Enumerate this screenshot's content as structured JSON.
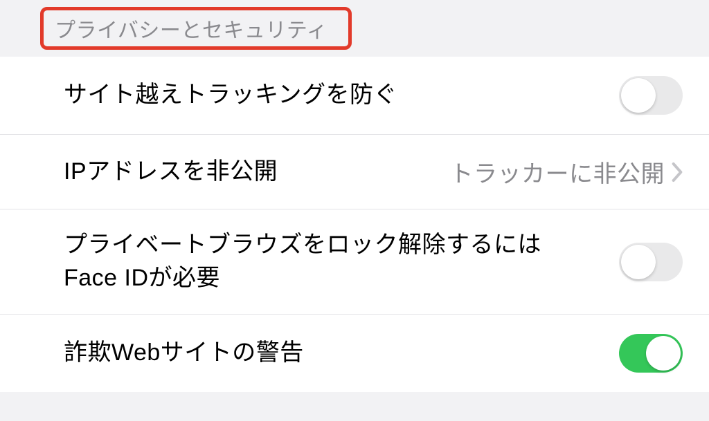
{
  "section": {
    "title": "プライバシーとセキュリティ"
  },
  "rows": {
    "cross_site_tracking": {
      "label": "サイト越えトラッキングを防ぐ",
      "enabled": false
    },
    "hide_ip": {
      "label": "IPアドレスを非公開",
      "value": "トラッカーに非公開"
    },
    "private_browsing_lock": {
      "label": "プライベートブラウズをロック解除するにはFace IDが必要",
      "enabled": false
    },
    "fraud_warning": {
      "label": "詐欺Webサイトの警告",
      "enabled": true
    }
  },
  "colors": {
    "accent_green": "#34c759",
    "highlight_red": "#e23a2a",
    "secondary_text": "#8a8a8e"
  }
}
